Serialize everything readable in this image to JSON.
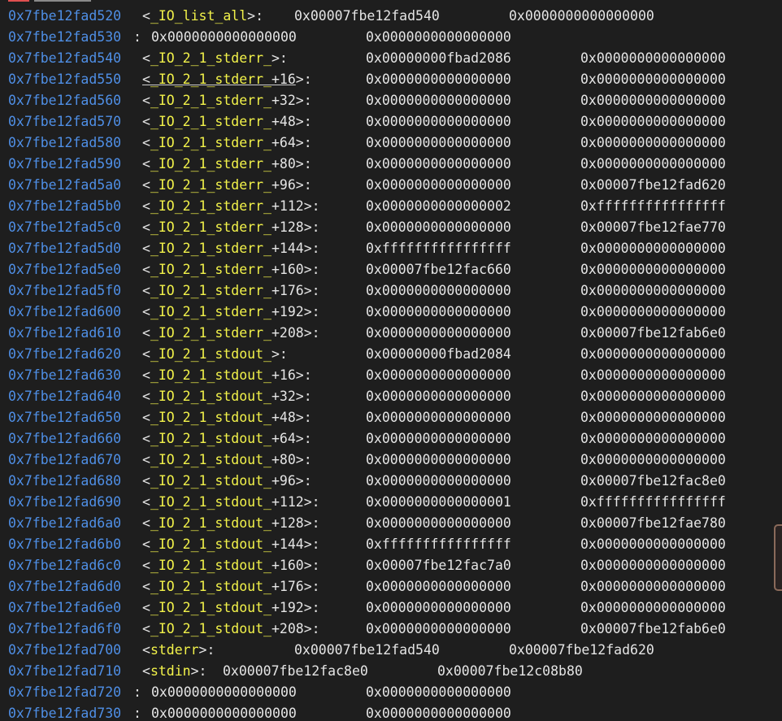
{
  "terminal": {
    "rows": [
      {
        "addr": "0x7fbe12fad520",
        "sym_name": "_IO_list_all",
        "sym_offset": "",
        "v1": "0x00007fbe12fad540",
        "v2": "0x0000000000000000"
      },
      {
        "addr": "0x7fbe12fad530",
        "sym_name": "",
        "sym_offset": "",
        "v1": "0x0000000000000000",
        "v2": "0x0000000000000000"
      },
      {
        "addr": "0x7fbe12fad540",
        "sym_name": "_IO_2_1_stderr_",
        "sym_offset": "",
        "v1": "0x00000000fbad2086",
        "v2": "0x0000000000000000"
      },
      {
        "addr": "0x7fbe12fad550",
        "sym_name": "_IO_2_1_stderr_",
        "sym_offset": "+16",
        "v1": "0x0000000000000000",
        "v2": "0x0000000000000000"
      },
      {
        "addr": "0x7fbe12fad560",
        "sym_name": "_IO_2_1_stderr_",
        "sym_offset": "+32",
        "v1": "0x0000000000000000",
        "v2": "0x0000000000000000"
      },
      {
        "addr": "0x7fbe12fad570",
        "sym_name": "_IO_2_1_stderr_",
        "sym_offset": "+48",
        "v1": "0x0000000000000000",
        "v2": "0x0000000000000000"
      },
      {
        "addr": "0x7fbe12fad580",
        "sym_name": "_IO_2_1_stderr_",
        "sym_offset": "+64",
        "v1": "0x0000000000000000",
        "v2": "0x0000000000000000"
      },
      {
        "addr": "0x7fbe12fad590",
        "sym_name": "_IO_2_1_stderr_",
        "sym_offset": "+80",
        "v1": "0x0000000000000000",
        "v2": "0x0000000000000000"
      },
      {
        "addr": "0x7fbe12fad5a0",
        "sym_name": "_IO_2_1_stderr_",
        "sym_offset": "+96",
        "v1": "0x0000000000000000",
        "v2": "0x00007fbe12fad620"
      },
      {
        "addr": "0x7fbe12fad5b0",
        "sym_name": "_IO_2_1_stderr_",
        "sym_offset": "+112",
        "v1": "0x0000000000000002",
        "v2": "0xffffffffffffffff"
      },
      {
        "addr": "0x7fbe12fad5c0",
        "sym_name": "_IO_2_1_stderr_",
        "sym_offset": "+128",
        "v1": "0x0000000000000000",
        "v2": "0x00007fbe12fae770"
      },
      {
        "addr": "0x7fbe12fad5d0",
        "sym_name": "_IO_2_1_stderr_",
        "sym_offset": "+144",
        "v1": "0xffffffffffffffff",
        "v2": "0x0000000000000000"
      },
      {
        "addr": "0x7fbe12fad5e0",
        "sym_name": "_IO_2_1_stderr_",
        "sym_offset": "+160",
        "v1": "0x00007fbe12fac660",
        "v2": "0x0000000000000000"
      },
      {
        "addr": "0x7fbe12fad5f0",
        "sym_name": "_IO_2_1_stderr_",
        "sym_offset": "+176",
        "v1": "0x0000000000000000",
        "v2": "0x0000000000000000"
      },
      {
        "addr": "0x7fbe12fad600",
        "sym_name": "_IO_2_1_stderr_",
        "sym_offset": "+192",
        "v1": "0x0000000000000000",
        "v2": "0x0000000000000000"
      },
      {
        "addr": "0x7fbe12fad610",
        "sym_name": "_IO_2_1_stderr_",
        "sym_offset": "+208",
        "v1": "0x0000000000000000",
        "v2": "0x00007fbe12fab6e0"
      },
      {
        "addr": "0x7fbe12fad620",
        "sym_name": "_IO_2_1_stdout_",
        "sym_offset": "",
        "v1": "0x00000000fbad2084",
        "v2": "0x0000000000000000"
      },
      {
        "addr": "0x7fbe12fad630",
        "sym_name": "_IO_2_1_stdout_",
        "sym_offset": "+16",
        "v1": "0x0000000000000000",
        "v2": "0x0000000000000000"
      },
      {
        "addr": "0x7fbe12fad640",
        "sym_name": "_IO_2_1_stdout_",
        "sym_offset": "+32",
        "v1": "0x0000000000000000",
        "v2": "0x0000000000000000"
      },
      {
        "addr": "0x7fbe12fad650",
        "sym_name": "_IO_2_1_stdout_",
        "sym_offset": "+48",
        "v1": "0x0000000000000000",
        "v2": "0x0000000000000000"
      },
      {
        "addr": "0x7fbe12fad660",
        "sym_name": "_IO_2_1_stdout_",
        "sym_offset": "+64",
        "v1": "0x0000000000000000",
        "v2": "0x0000000000000000"
      },
      {
        "addr": "0x7fbe12fad670",
        "sym_name": "_IO_2_1_stdout_",
        "sym_offset": "+80",
        "v1": "0x0000000000000000",
        "v2": "0x0000000000000000"
      },
      {
        "addr": "0x7fbe12fad680",
        "sym_name": "_IO_2_1_stdout_",
        "sym_offset": "+96",
        "v1": "0x0000000000000000",
        "v2": "0x00007fbe12fac8e0"
      },
      {
        "addr": "0x7fbe12fad690",
        "sym_name": "_IO_2_1_stdout_",
        "sym_offset": "+112",
        "v1": "0x0000000000000001",
        "v2": "0xffffffffffffffff"
      },
      {
        "addr": "0x7fbe12fad6a0",
        "sym_name": "_IO_2_1_stdout_",
        "sym_offset": "+128",
        "v1": "0x0000000000000000",
        "v2": "0x00007fbe12fae780"
      },
      {
        "addr": "0x7fbe12fad6b0",
        "sym_name": "_IO_2_1_stdout_",
        "sym_offset": "+144",
        "v1": "0xffffffffffffffff",
        "v2": "0x0000000000000000"
      },
      {
        "addr": "0x7fbe12fad6c0",
        "sym_name": "_IO_2_1_stdout_",
        "sym_offset": "+160",
        "v1": "0x00007fbe12fac7a0",
        "v2": "0x0000000000000000"
      },
      {
        "addr": "0x7fbe12fad6d0",
        "sym_name": "_IO_2_1_stdout_",
        "sym_offset": "+176",
        "v1": "0x0000000000000000",
        "v2": "0x0000000000000000"
      },
      {
        "addr": "0x7fbe12fad6e0",
        "sym_name": "_IO_2_1_stdout_",
        "sym_offset": "+192",
        "v1": "0x0000000000000000",
        "v2": "0x0000000000000000"
      },
      {
        "addr": "0x7fbe12fad6f0",
        "sym_name": "_IO_2_1_stdout_",
        "sym_offset": "+208",
        "v1": "0x0000000000000000",
        "v2": "0x00007fbe12fab6e0"
      },
      {
        "addr": "0x7fbe12fad700",
        "sym_name": "stderr",
        "sym_offset": "",
        "v1": "0x00007fbe12fad540",
        "v2": "0x00007fbe12fad620"
      },
      {
        "addr": "0x7fbe12fad710",
        "sym_name": "stdin",
        "sym_offset": "",
        "v1": "0x00007fbe12fac8e0",
        "v2": "0x00007fbe12c08b80"
      },
      {
        "addr": "0x7fbe12fad720",
        "sym_name": "",
        "sym_offset": "",
        "v1": "0x0000000000000000",
        "v2": "0x0000000000000000"
      },
      {
        "addr": "0x7fbe12fad730",
        "sym_name": "",
        "sym_offset": "",
        "v1": "0x0000000000000000",
        "v2": "0x0000000000000000"
      }
    ]
  },
  "colors": {
    "background": "#1e1e1e",
    "address": "#4f8fe6",
    "symbol": "#f2f24a",
    "text": "#e5e5e5",
    "prompt_fragment": "#e05050"
  }
}
